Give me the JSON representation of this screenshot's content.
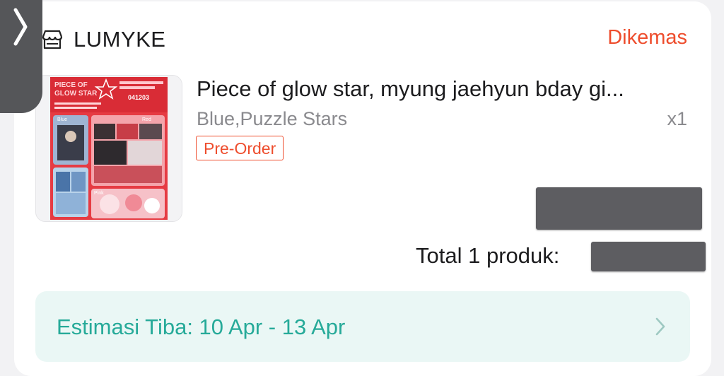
{
  "shop": {
    "name": "LUMYKE",
    "status": "Dikemas"
  },
  "order_item": {
    "thumbnail": {
      "title_line1": "PIECE OF",
      "title_line2": "GLOW STAR",
      "code": "041203",
      "label_blue": "Blue",
      "label_red": "Red",
      "label_pink": "Pink",
      "accent_color": "#ea3a42"
    },
    "title": "Piece of glow star, myung jaehyun bday gi...",
    "variant": "Blue,Puzzle Stars",
    "quantity": "x1",
    "badge": "Pre-Order"
  },
  "summary": {
    "total_label": "Total 1 produk:"
  },
  "delivery": {
    "estimate": "Estimasi Tiba: 10 Apr - 13 Apr"
  },
  "colors": {
    "accent": "#ee4d2d",
    "teal": "#26aa99",
    "teal_bg": "#eaf7f5",
    "redaction": "#5d5d61"
  },
  "icons": {
    "side_handle": "chevron-right-icon",
    "store": "store-icon",
    "eta_arrow": "chevron-right-icon"
  }
}
